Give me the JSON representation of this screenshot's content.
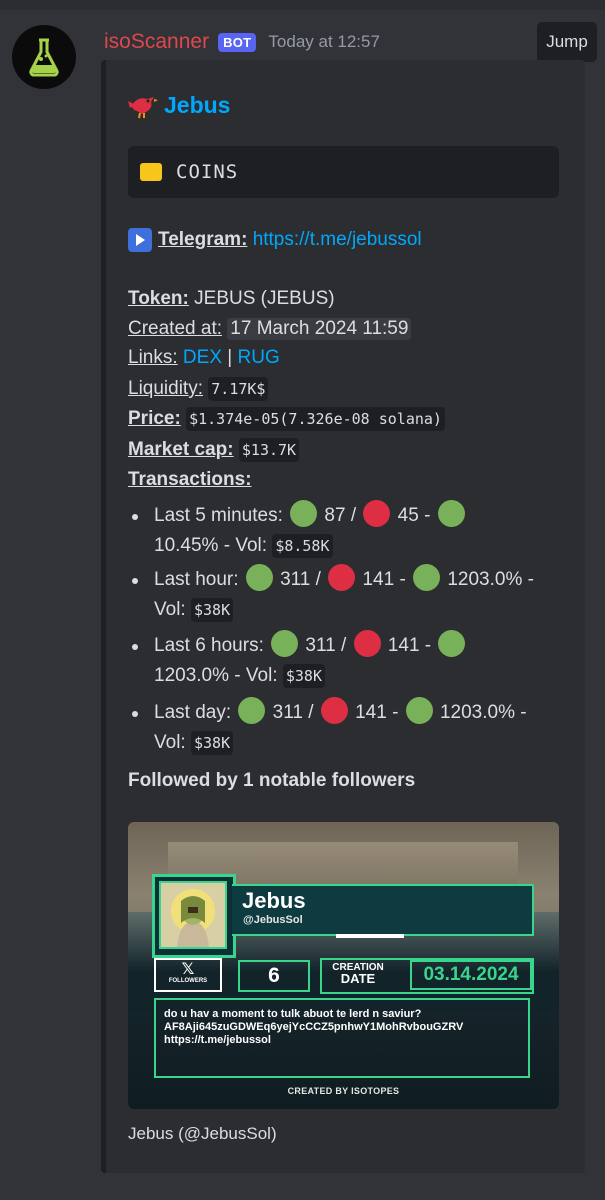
{
  "message": {
    "username": "isoScanner",
    "badge": "BOT",
    "timestamp": "Today at 12:57",
    "jump_label": "Jump",
    "avatar_icon": "flask-icon"
  },
  "embed": {
    "author_icon": "bird-icon",
    "author_name": "Jebus",
    "code_label": "COINS",
    "telegram_label": "Telegram:",
    "telegram_url": "https://t.me/jebussol",
    "token_label": "Token:",
    "token_value": "JEBUS (JEBUS)",
    "created_label": "Created at:",
    "created_value": "17 March 2024 11:59",
    "links_label": "Links:",
    "link_dex": "DEX",
    "link_sep": "|",
    "link_rug": "RUG",
    "liquidity_label": "Liquidity:",
    "liquidity_value": "7.17K$",
    "price_label": "Price:",
    "price_value": "$1.374e-05(7.326e-08 solana)",
    "mcap_label": "Market cap:",
    "mcap_value": "$13.7K",
    "transactions_label": "Transactions:",
    "transactions": [
      {
        "l1_label": "Last 5 minutes:",
        "buys": "87",
        "sells": "45",
        "pct": "10.45%",
        "vol": "$8.58K"
      },
      {
        "label": "Last hour:",
        "buys": "311",
        "sells": "141",
        "pct": "1203.0%",
        "vol": "$38K"
      },
      {
        "label": "Last 6 hours:",
        "buys": "311",
        "sells": "141",
        "pct": "1203.0%",
        "vol": "$38K"
      },
      {
        "label": "Last day:",
        "buys": "311",
        "sells": "141",
        "pct": "1203.0%",
        "vol": "$38K"
      }
    ],
    "followed_label": "Followed by 1 notable followers",
    "card": {
      "name": "Jebus",
      "handle": "@JebusSol",
      "followers_label": "FOLLOWERS",
      "followers_count": "6",
      "created_label_1": "CREATION",
      "created_label_2": "DATE",
      "created_date": "03.14.2024",
      "desc_1": "do u hav a moment to tulk abuot te lerd n saviur?",
      "desc_2": "AF8Aji645zuGDWEq6yejYcCCZ5pnhwY1MohRvbouGZRV",
      "desc_3": "https://t.me/jebussol",
      "created_by": "CREATED BY ISOTOPES"
    },
    "footer": "Jebus (@JebusSol)"
  }
}
